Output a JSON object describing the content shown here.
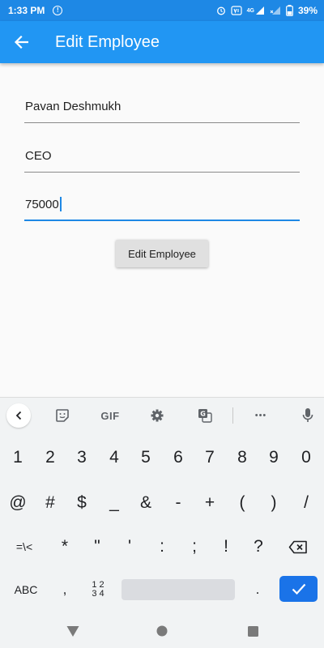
{
  "status_bar": {
    "time": "1:33 PM",
    "network": "4G",
    "battery": "39%"
  },
  "app_bar": {
    "title": "Edit Employee",
    "color": "#2196f3"
  },
  "form": {
    "name_value": "Pavan Deshmukh",
    "position_value": "CEO",
    "salary_value": "75000",
    "submit_label": "Edit Employee"
  },
  "keyboard": {
    "toolbar": {
      "gif_label": "GIF",
      "more_label": "•••"
    },
    "row1": [
      "1",
      "2",
      "3",
      "4",
      "5",
      "6",
      "7",
      "8",
      "9",
      "0"
    ],
    "row2": [
      "@",
      "#",
      "$",
      "_",
      "&",
      "-",
      "+",
      "(",
      ")",
      "/"
    ],
    "row3": [
      "=\\<",
      "*",
      "\"",
      "'",
      ":",
      ";",
      "!",
      "?"
    ],
    "row4": {
      "abc_label": "ABC",
      "comma": ",",
      "num_top": "1 2",
      "num_bottom": "3 4",
      "period": "."
    },
    "accent_color": "#1a73e8"
  }
}
